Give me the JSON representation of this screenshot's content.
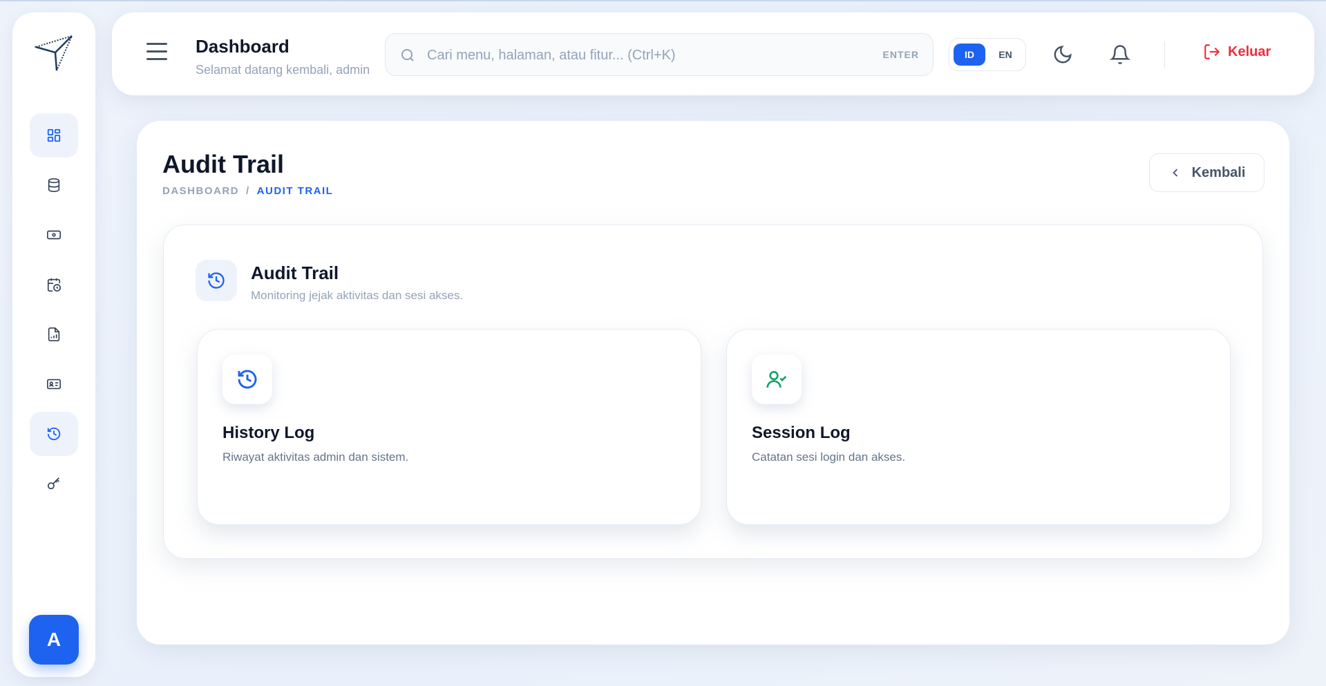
{
  "header": {
    "title": "Dashboard",
    "subtitle": "Selamat datang kembali, admin",
    "search_placeholder": "Cari menu, halaman, atau fitur... (Ctrl+K)",
    "search_hint": "ENTER",
    "lang_id": "ID",
    "lang_en": "EN",
    "logout_label": "Keluar"
  },
  "sidebar": {
    "items": [
      {
        "name": "dashboard",
        "icon": "grid-icon",
        "active": true
      },
      {
        "name": "database",
        "icon": "database-icon",
        "active": false
      },
      {
        "name": "payment",
        "icon": "cash-icon",
        "active": false
      },
      {
        "name": "schedule",
        "icon": "calendar-clock-icon",
        "active": false
      },
      {
        "name": "report",
        "icon": "file-chart-icon",
        "active": false
      },
      {
        "name": "id-card",
        "icon": "id-card-icon",
        "active": false
      },
      {
        "name": "audit-trail",
        "icon": "history-icon",
        "active": true
      },
      {
        "name": "access-key",
        "icon": "key-icon",
        "active": false
      }
    ],
    "avatar_initial": "A"
  },
  "page": {
    "title": "Audit Trail",
    "breadcrumb": [
      "DASHBOARD",
      "/",
      "AUDIT TRAIL"
    ],
    "back_label": "Kembali"
  },
  "panel": {
    "title": "Audit Trail",
    "subtitle": "Monitoring jejak aktivitas dan sesi akses.",
    "cards": [
      {
        "title": "History Log",
        "subtitle": "Riwayat aktivitas admin dan sistem.",
        "icon": "history-icon"
      },
      {
        "title": "Session Log",
        "subtitle": "Catatan sesi login dan akses.",
        "icon": "user-check-icon"
      }
    ]
  },
  "colors": {
    "accent": "#1d63f0",
    "danger": "#ef2d3c",
    "success": "#16a36a"
  }
}
